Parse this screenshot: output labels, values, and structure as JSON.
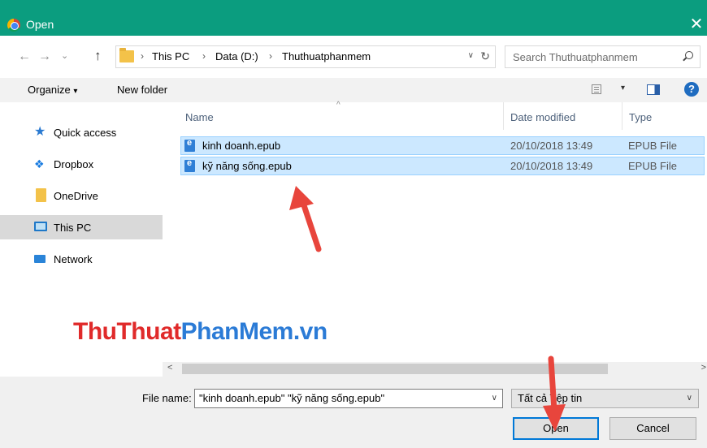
{
  "window": {
    "title": "Open",
    "close_glyph": "✕"
  },
  "nav": {
    "back_glyph": "←",
    "forward_glyph": "→",
    "recent_glyph": "⌄",
    "up_glyph": "↑",
    "breadcrumb": [
      "This PC",
      "Data (D:)",
      "Thuthuatphanmem"
    ],
    "separator": "›",
    "dropdown_glyph": "∨",
    "refresh_glyph": "↻"
  },
  "search": {
    "placeholder": "Search Thuthuatphanmem"
  },
  "toolbar": {
    "organize_label": "Organize",
    "organize_caret": "▾",
    "new_folder_label": "New folder",
    "view_caret": "▾",
    "help_glyph": "?"
  },
  "sidebar": {
    "items": [
      {
        "label": "Quick access",
        "icon": "star-icon"
      },
      {
        "label": "Dropbox",
        "icon": "dropbox-icon"
      },
      {
        "label": "OneDrive",
        "icon": "onedrive-icon"
      },
      {
        "label": "This PC",
        "icon": "computer-icon",
        "selected": true
      },
      {
        "label": "Network",
        "icon": "network-icon"
      }
    ]
  },
  "files": {
    "columns": [
      "Name",
      "Date modified",
      "Type"
    ],
    "sort_glyph": "^",
    "rows": [
      {
        "name": "kinh doanh.epub",
        "date": "20/10/2018 13:49",
        "type": "EPUB File",
        "selected": true
      },
      {
        "name": "kỹ năng sống.epub",
        "date": "20/10/2018 13:49",
        "type": "EPUB File",
        "selected": true
      }
    ]
  },
  "watermark": {
    "part1": "ThuThuat",
    "part2": "PhanMem",
    "part3": ".vn"
  },
  "scrollbar": {
    "left_glyph": "<",
    "right_glyph": ">"
  },
  "footer": {
    "file_name_label": "File name:",
    "file_name_value": "\"kinh doanh.epub\" \"kỹ năng sống.epub\"",
    "dropdown_glyph": "∨",
    "file_type_value": "Tất cả Tệp tin",
    "open_label": "Open",
    "cancel_label": "Cancel"
  },
  "colors": {
    "titlebar": "#0b9d7f",
    "selection": "#cce8ff",
    "annotation_arrow": "#e8453c",
    "primary_button_border": "#0078d7"
  }
}
